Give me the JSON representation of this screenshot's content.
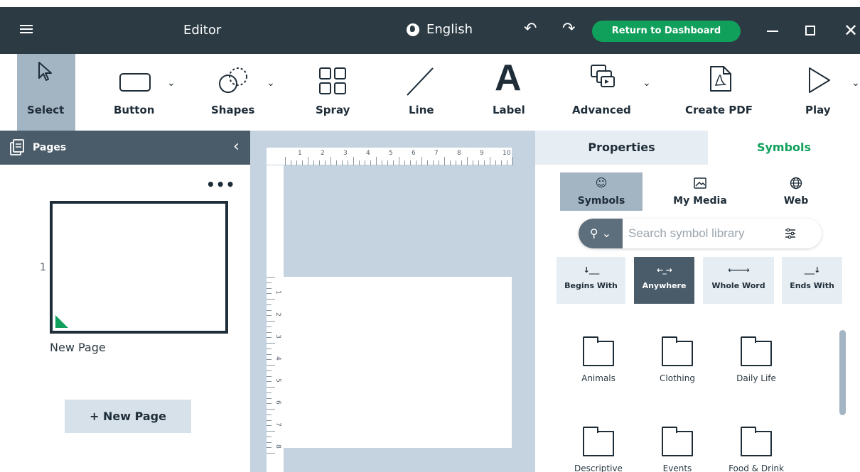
{
  "titlebar": {
    "title": "Editor",
    "language": "English",
    "dashboard_button": "Return to Dashboard",
    "undo_icon": "undo-icon",
    "redo_icon": "redo-icon"
  },
  "toolbar": {
    "tools": [
      {
        "label": "Select",
        "icon": "cursor-icon"
      },
      {
        "label": "Button",
        "icon": "button-shape-icon"
      },
      {
        "label": "Shapes",
        "icon": "shapes-icon"
      },
      {
        "label": "Spray",
        "icon": "spray-grid-icon"
      },
      {
        "label": "Line",
        "icon": "line-icon"
      },
      {
        "label": "Label",
        "icon": "label-a-icon"
      },
      {
        "label": "Advanced",
        "icon": "advanced-icon"
      },
      {
        "label": "Create PDF",
        "icon": "pdf-icon"
      },
      {
        "label": "Play",
        "icon": "play-icon"
      }
    ]
  },
  "pages": {
    "title": "Pages",
    "items": [
      {
        "number": "1",
        "name": "New Page"
      }
    ],
    "new_page_button": "+ New Page"
  },
  "ruler": {
    "top_numbers": [
      "1",
      "2",
      "3",
      "4",
      "5",
      "6",
      "7",
      "8",
      "9",
      "10"
    ],
    "left_numbers": [
      "1",
      "2",
      "3",
      "4",
      "5",
      "6",
      "7",
      "8"
    ]
  },
  "right_panel": {
    "tabs": [
      "Properties",
      "Symbols"
    ],
    "sources": [
      "Symbols",
      "My Media",
      "Web"
    ],
    "search_placeholder": "Search symbol library",
    "match_modes": [
      {
        "label": "Begins With",
        "symbol": "↓___"
      },
      {
        "label": "Anywhere",
        "symbol": "←_→"
      },
      {
        "label": "Whole Word",
        "symbol": "⟵⟶"
      },
      {
        "label": "Ends With",
        "symbol": "___↓"
      }
    ],
    "folders": [
      "Animals",
      "Clothing",
      "Daily Life",
      "Descriptive",
      "Events",
      "Food & Drink"
    ]
  },
  "colors": {
    "titlebar": "#2b3a43",
    "accent_green": "#10a05c",
    "active_tool": "#a3b4c3",
    "canvas_bg": "#c4d3df"
  }
}
